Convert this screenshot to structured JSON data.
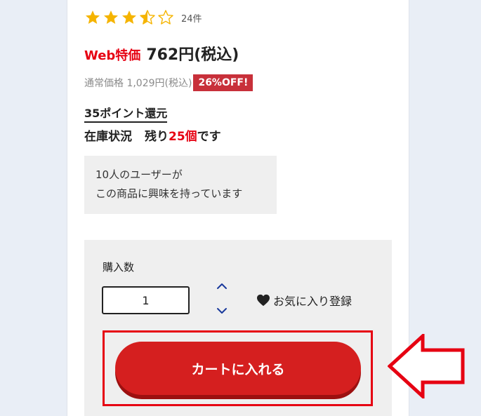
{
  "rating": {
    "stars": 3.5,
    "max": 5,
    "count_label": "24件",
    "star_color": "#f5b400"
  },
  "price": {
    "web_label": "Web特価",
    "web_price": "762円(税込)",
    "regular_price": "通常価格 1,029円(税込)",
    "discount_badge": "26%OFF!"
  },
  "points": "35ポイント還元",
  "stock": {
    "label": "在庫状況",
    "prefix": "残り",
    "count": "25個",
    "suffix": "です"
  },
  "interest": {
    "line1": "10人のユーザーが",
    "line2": "この商品に興味を持っています"
  },
  "purchase": {
    "quantity_label": "購入数",
    "quantity_value": "1",
    "favorite_label": "お気に入り登録",
    "cart_button": "カートに入れる"
  },
  "colors": {
    "accent_red": "#e60012",
    "cart_button": "#d51f1f",
    "badge": "#c8303a",
    "stepper": "#1a3a9c"
  }
}
